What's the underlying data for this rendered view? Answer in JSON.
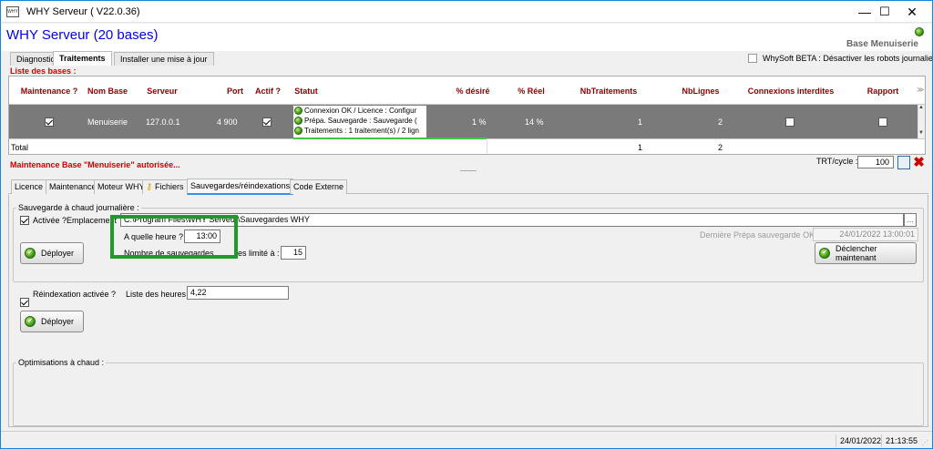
{
  "window": {
    "title": "WHY Serveur ( V22.0.36)",
    "icon_text": "WHY",
    "controls": {
      "minimize": "—",
      "maximize": "☐",
      "close": "✕"
    }
  },
  "header": {
    "app_title": "WHY Serveur (20 bases)",
    "database_label": "Base Menuiserie",
    "beta_option": "WhySoft BETA : Désactiver les robots journaliers"
  },
  "tabs": [
    "Diagnostic",
    "Traitements",
    "Installer une mise à jour"
  ],
  "active_tab": "Traitements",
  "grid": {
    "section_label": "Liste des bases :",
    "columns": [
      "Maintenance ?",
      "Nom Base",
      "Serveur",
      "Port",
      "Actif ?",
      "Statut",
      "% désiré",
      "% Réel",
      "NbTraitements",
      "NbLignes",
      "Connexions interdites",
      "Rapport"
    ],
    "row": {
      "maintenance": true,
      "nom_base": "Menuiserie",
      "serveur": "127.0.0.1",
      "port": "4 900",
      "actif": true,
      "statut": [
        "Connexion OK / Licence : Configur",
        "Prépa. Sauvegarde : Sauvegarde (",
        "Traitements : 1 traitement(s) / 2 lign"
      ],
      "pct_desire": "1 %",
      "pct_reel": "14 %",
      "nb_traitements": "1",
      "nb_lignes": "2",
      "connexions_interdites": false,
      "rapport": false
    },
    "total": {
      "label": "Total",
      "nb_traitements": "1",
      "nb_lignes": "2"
    }
  },
  "maintenance_notice": "Maintenance Base \"Menuiserie\" autorisée...",
  "trt": {
    "label": "TRT/cycle :",
    "value": "100"
  },
  "subtabs": [
    "Licence",
    "Maintenance",
    "Moteur WHY",
    "Fichiers",
    "Sauvegardes/réindexations",
    "Code Externe"
  ],
  "active_subtab": "Sauvegardes/réindexations",
  "backup": {
    "group_label": "Sauvegarde à chaud journalière :",
    "activated_label": "Activée ?",
    "activated": true,
    "location_label": "Emplacement",
    "location_value": "C:\\Program Files\\WHY Serveur\\Sauvegardes WHY",
    "browse_label": "...",
    "time_label": "A quelle heure ?",
    "time_value": "13:00",
    "limit_label_start": "Nombre de sauvegardes",
    "limit_label_end": "es limité à :",
    "limit_value": "15",
    "last_prep_label": "Dernière Prépa sauvegarde OK :",
    "last_prep_value": "24/01/2022 13:00:01",
    "deploy_label": "Déployer",
    "trigger_label": "Déclencher maintenant"
  },
  "reindex": {
    "activated_label": "Réindexation activée ?",
    "activated": true,
    "hours_label": "Liste des heures ?",
    "hours_value": "4,22",
    "deploy_label": "Déployer"
  },
  "optimisations": {
    "group_label": "Optimisations à chaud :"
  },
  "statusbar": {
    "date": "24/01/2022",
    "time": "21:13:55"
  },
  "colors": {
    "accent_title": "#0000ee",
    "red_label": "#d00000",
    "highlight": "#1f9a2a",
    "header_text": "#8b0000"
  }
}
